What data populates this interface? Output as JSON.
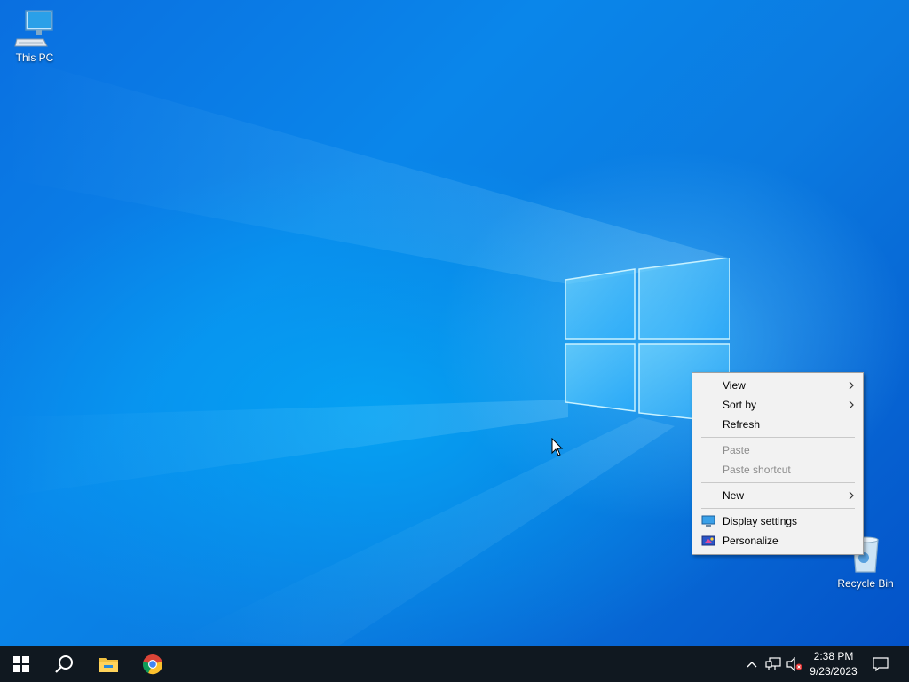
{
  "desktop": {
    "icons": [
      {
        "label": "This PC",
        "icon": "computer-icon"
      },
      {
        "label": "Recycle Bin",
        "icon": "recycle-bin-icon"
      }
    ]
  },
  "context_menu": {
    "items": [
      {
        "label": "View",
        "enabled": true,
        "submenu": true
      },
      {
        "label": "Sort by",
        "enabled": true,
        "submenu": true
      },
      {
        "label": "Refresh",
        "enabled": true
      },
      {
        "label": "Paste",
        "enabled": false
      },
      {
        "label": "Paste shortcut",
        "enabled": false
      },
      {
        "label": "New",
        "enabled": true,
        "submenu": true
      },
      {
        "label": "Display settings",
        "enabled": true,
        "icon": "display-settings-icon"
      },
      {
        "label": "Personalize",
        "enabled": true,
        "icon": "personalize-icon"
      }
    ]
  },
  "taskbar": {
    "apps": [
      "start-icon",
      "search-icon",
      "file-explorer-icon",
      "chrome-icon"
    ],
    "tray_icons": [
      "chevron-up-icon",
      "network-icon",
      "volume-muted-icon"
    ],
    "clock": {
      "time": "2:38 PM",
      "date": "9/23/2023"
    }
  },
  "colors": {
    "taskbar": "#101820",
    "menu_bg": "#f2f2f2",
    "accent": "#0a78e0"
  }
}
